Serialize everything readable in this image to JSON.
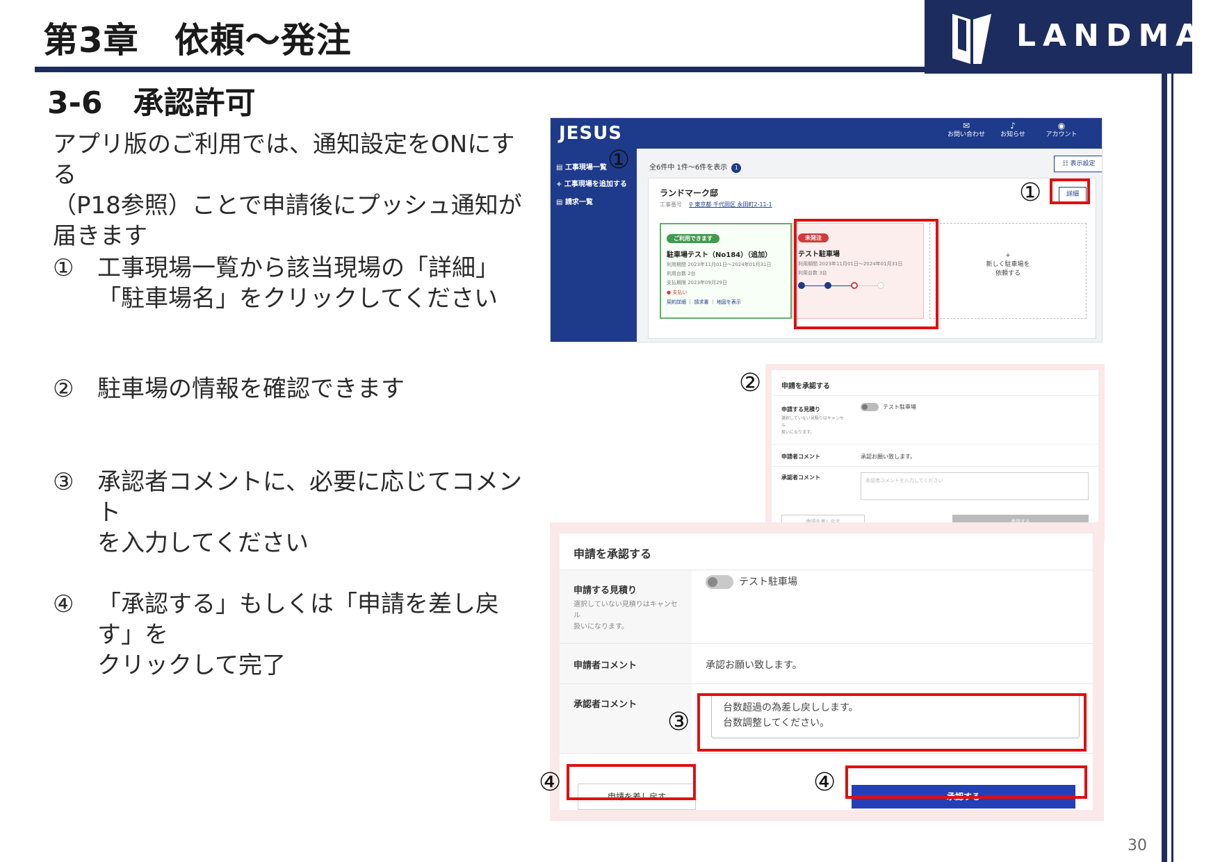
{
  "header": {
    "chapter_title": "第3章　依頼～発注",
    "logo_text": "LANDMARK",
    "brand_color": "#1c2c5e"
  },
  "section_title": "3-6　承認許可",
  "intro_lines": [
    "アプリ版のご利用では、通知設定をONにする",
    "（P18参照）ことで申請後にプッシュ通知が",
    "届きます"
  ],
  "steps": [
    {
      "num": "①",
      "lines": [
        "工事現場一覧から該当現場の「詳細」",
        "「駐車場名」をクリックしてください"
      ]
    },
    {
      "num": "②",
      "lines": [
        "駐車場の情報を確認できます"
      ]
    },
    {
      "num": "③",
      "lines": [
        "承認者コメントに、必要に応じてコメント",
        "を入力してください"
      ]
    },
    {
      "num": "④",
      "lines": [
        "「承認する」もしくは「申請を差し戻す」を",
        "クリックして完了"
      ]
    }
  ],
  "markers": {
    "m1": "①",
    "m2": "②",
    "m3": "③",
    "m4": "④"
  },
  "app": {
    "logo": "JESUS",
    "top_icons": [
      "お問い合わせ",
      "お知らせ",
      "アカウント"
    ],
    "side_items": [
      "工事現場一覧",
      "工事現場を追加する",
      "請求一覧"
    ],
    "count_text": "全6件中 1件～6件を表示",
    "count_badge": "1",
    "display_settings": "表示設定",
    "site_name": "ランドマーク邸",
    "site_label": "工事番号",
    "site_address": "東京都 千代田区 永田町2-11-1",
    "detail_button": "詳細",
    "cards": [
      {
        "badge": "ご利用できます",
        "name": "駐車場テスト（No184）（追加）",
        "meta": [
          "利用期間 2023年11月01日～2024年01月31日",
          "利用台数 2台",
          "支払期限 2023年09月29日"
        ],
        "due": "● 支払い",
        "links": "契約詳細 ｜ 請求書 ｜ 地図を表示"
      },
      {
        "badge": "未発注",
        "name": "テスト駐車場",
        "meta": [
          "利用期間 2023年11月01日～2024年01月31日",
          "利用台数 3台"
        ]
      }
    ],
    "add_card": [
      "+",
      "新しく駐車場を",
      "依頼する"
    ]
  },
  "dialog_small": {
    "title": "申請を承認する",
    "estimate_label": "申請する見積り",
    "estimate_note": [
      "選択していない見積りはキャンセ",
      "ル",
      "扱いになります。"
    ],
    "estimate_value": "テスト駐車場",
    "applicant_label": "申請者コメント",
    "applicant_value": "承認お願い致します。",
    "approver_label": "承認者コメント",
    "approver_placeholder": "承認者コメントを入力してください",
    "back_button": "申請を差し戻す",
    "approve_button": "承認する"
  },
  "dialog_large": {
    "title": "申請を承認する",
    "estimate_label": "申請する見積り",
    "estimate_note": [
      "選択していない見積りはキャンセ",
      "ル",
      "扱いになります。"
    ],
    "estimate_value": "テスト駐車場",
    "applicant_label": "申請者コメント",
    "applicant_value": "承認お願い致します。",
    "approver_label": "承認者コメント",
    "approver_text": [
      "台数超過の為差し戻しします。",
      "台数調整してください。"
    ],
    "back_button": "申請を差し戻す",
    "approve_button": "承認する"
  },
  "page_number": "30"
}
